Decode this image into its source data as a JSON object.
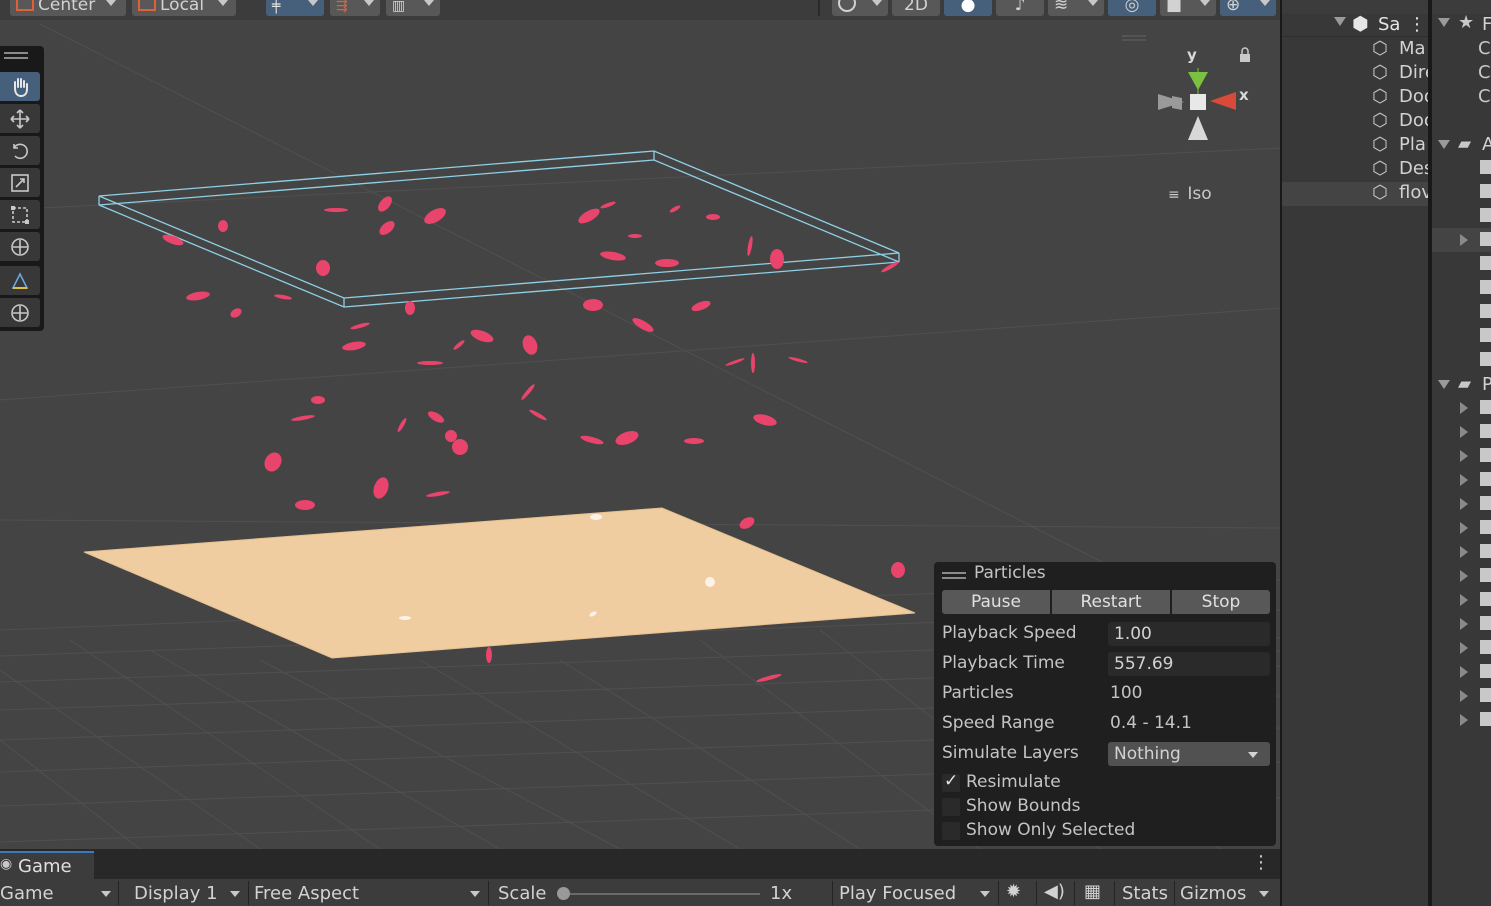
{
  "toolbar": {
    "pivot_label": "Center",
    "space_label": "Local",
    "mode_2d_label": "2D"
  },
  "scene": {
    "projection_label": "Iso",
    "gizmo": {
      "y_label": "y",
      "x_label": "x"
    }
  },
  "particles_panel": {
    "title": "Particles",
    "buttons": {
      "pause": "Pause",
      "restart": "Restart",
      "stop": "Stop"
    },
    "playback_speed": {
      "label": "Playback Speed",
      "value": "1.00"
    },
    "playback_time": {
      "label": "Playback Time",
      "value": "557.69"
    },
    "particles": {
      "label": "Particles",
      "value": "100"
    },
    "speed_range": {
      "label": "Speed Range",
      "value": "0.4 - 14.1"
    },
    "simulate_layers": {
      "label": "Simulate Layers",
      "value": "Nothing"
    },
    "resimulate": {
      "label": "Resimulate",
      "checked": true
    },
    "show_bounds": {
      "label": "Show Bounds",
      "checked": false
    },
    "show_only_selected": {
      "label": "Show Only Selected",
      "checked": false
    }
  },
  "hierarchy": {
    "scene_name": "Sa",
    "items": [
      {
        "label": "Ma"
      },
      {
        "label": "Dire"
      },
      {
        "label": "Doo"
      },
      {
        "label": "Doo"
      },
      {
        "label": "Pla"
      },
      {
        "label": "Des"
      },
      {
        "label": "flov"
      }
    ]
  },
  "project": {
    "favorites_label": "F",
    "fav_items": [
      "C",
      "C",
      "C"
    ],
    "assets_label": "A",
    "packages_label": "P"
  },
  "game": {
    "tab_label": "Game",
    "view_label": "Game",
    "display_label": "Display 1",
    "aspect_label": "Free Aspect",
    "scale_label": "Scale",
    "scale_value": "1x",
    "scale_fraction": 0.0,
    "play_mode_label": "Play Focused",
    "stats_label": "Stats",
    "gizmos_label": "Gizmos"
  },
  "colors": {
    "scene_bg": "#444444",
    "selection_outline": "#8fd0e6",
    "petal": "#e8446c",
    "floor": "#f0cda0",
    "active_tool": "#46607c"
  }
}
